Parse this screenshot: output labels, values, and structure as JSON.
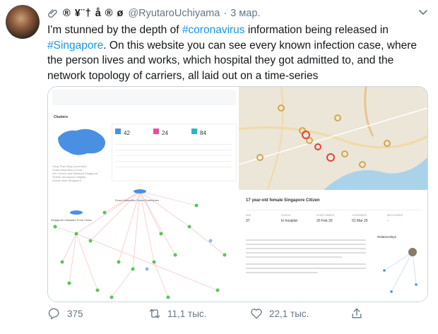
{
  "tweet": {
    "author_name": "® ¥¨† å ® ø",
    "handle": "@RyutaroUchiyama",
    "separator": "·",
    "date": "3 мар.",
    "text_parts": [
      {
        "t": "I'm stunned by the depth of "
      },
      {
        "t": "#coronavirus",
        "hash": true
      },
      {
        "t": " information being released in "
      },
      {
        "t": "#Singapore",
        "hash": true
      },
      {
        "t": ". On this website you can see every known infection case, where the person lives and works, which hospital they got admitted to, and the network topology of carriers, all laid out on a time-series"
      }
    ]
  },
  "media": {
    "stats": {
      "total": "42",
      "hospitalised": "24",
      "recovered": "84"
    },
    "clusters_title": "Clusters",
    "cluster_list": [
      "Yong Thai Hang (Lavender)",
      "Grace Assembly of God",
      "Life Church and Missions Singapore",
      "Seletar Aerospace Heights",
      "Grand Hyatt Singapore"
    ],
    "graph_labels": [
      "Grace Assembly Room Sometimes",
      "Singapore Indicated From China"
    ],
    "case_header": "17 year-old female Singapore Citizen",
    "case_fields": [
      {
        "label": "AGE",
        "value": "37"
      },
      {
        "label": "STATUS",
        "value": "In hospital"
      },
      {
        "label": "SYMPTOMATIC",
        "value": "20 Feb 20"
      },
      {
        "label": "CONFIRMED",
        "value": "01 Mar 20"
      },
      {
        "label": "RECOVERED",
        "value": "-"
      }
    ],
    "relationships_label": "Relationships"
  },
  "actions": {
    "replies": "375",
    "retweets": "11,1 тыс.",
    "likes": "22,1 тыс."
  },
  "colors": {
    "accent": "#1b95e0",
    "muted": "#657786"
  }
}
